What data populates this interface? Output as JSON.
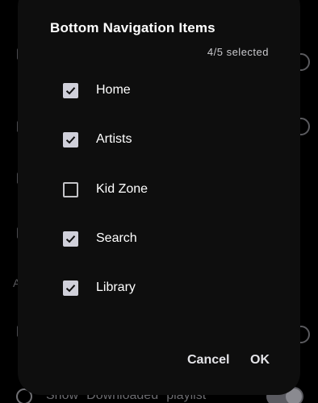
{
  "dialog": {
    "title": "Bottom Navigation Items",
    "selected_count": "4/5 selected",
    "options": [
      {
        "label": "Home",
        "checked": true
      },
      {
        "label": "Artists",
        "checked": true
      },
      {
        "label": "Kid Zone",
        "checked": false
      },
      {
        "label": "Search",
        "checked": true
      },
      {
        "label": "Library",
        "checked": true
      }
    ],
    "cancel_label": "Cancel",
    "ok_label": "OK"
  },
  "background": {
    "bottom_row_label": "Show \"Downloaded\" playlist",
    "section_letter": "A"
  },
  "colors": {
    "dialog_background": "#0e0e0e",
    "checkbox_checked": "#d0d0da",
    "screen_background": "#000000"
  }
}
